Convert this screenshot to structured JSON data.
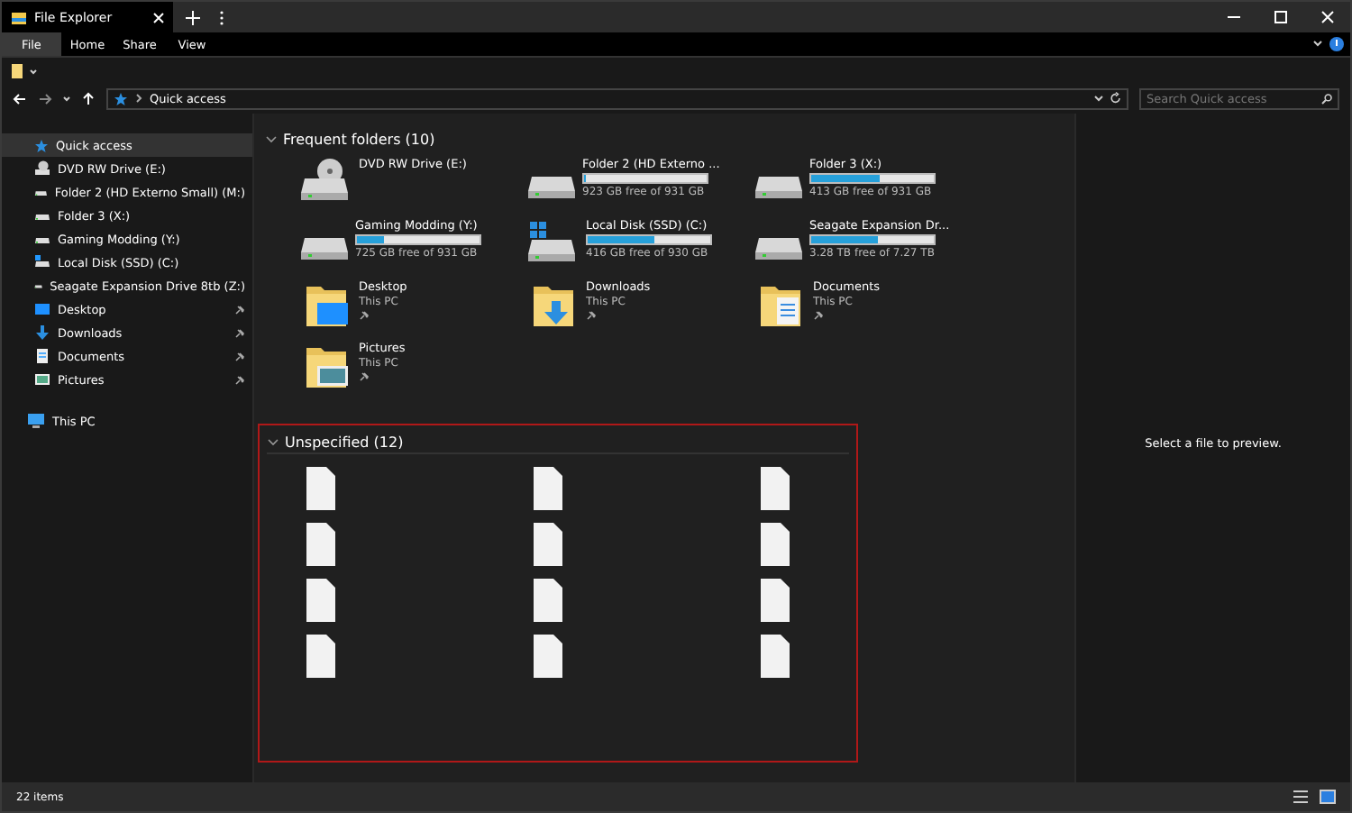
{
  "window": {
    "title": "File Explorer"
  },
  "ribbon_tabs": [
    {
      "label": "File",
      "selected": true
    },
    {
      "label": "Home",
      "selected": false
    },
    {
      "label": "Share",
      "selected": false
    },
    {
      "label": "View",
      "selected": false
    }
  ],
  "address": {
    "path": "Quick access"
  },
  "search": {
    "placeholder": "Search Quick access"
  },
  "sidebar": {
    "items": [
      {
        "kind": "quick",
        "label": "Quick access",
        "selected": true,
        "children": [
          {
            "kind": "dvd",
            "label": "DVD RW Drive (E:)",
            "pinned": false
          },
          {
            "kind": "drive",
            "label": "Folder 2 (HD Externo Small) (M:)",
            "pinned": false
          },
          {
            "kind": "drive",
            "label": "Folder 3 (X:)",
            "pinned": false
          },
          {
            "kind": "drive",
            "label": "Gaming Modding (Y:)",
            "pinned": false
          },
          {
            "kind": "system-drive",
            "label": "Local Disk (SSD) (C:)",
            "pinned": false
          },
          {
            "kind": "drive",
            "label": "Seagate Expansion Drive 8tb (Z:)",
            "pinned": false
          },
          {
            "kind": "desktop",
            "label": "Desktop",
            "pinned": true
          },
          {
            "kind": "downloads",
            "label": "Downloads",
            "pinned": true
          },
          {
            "kind": "documents",
            "label": "Documents",
            "pinned": true
          },
          {
            "kind": "pictures",
            "label": "Pictures",
            "pinned": true
          }
        ]
      },
      {
        "kind": "pc",
        "label": "This PC",
        "selected": false
      }
    ]
  },
  "frequent": {
    "heading": "Frequent folders (10)",
    "expanded": true,
    "items": [
      {
        "kind": "dvd",
        "name": "DVD RW Drive (E:)"
      },
      {
        "kind": "drive",
        "name": "Folder 2 (HD Externo ...",
        "level": 0.01,
        "detail": "923 GB free of 931 GB"
      },
      {
        "kind": "drive",
        "name": "Folder 3 (X:)",
        "level": 0.56,
        "detail": "413 GB free of 931 GB"
      },
      {
        "kind": "drive",
        "name": "Gaming Modding (Y:)",
        "level": 0.22,
        "detail": "725 GB free of 931 GB"
      },
      {
        "kind": "system-drive",
        "name": "Local Disk (SSD) (C:)",
        "level": 0.55,
        "detail": "416 GB free of 930 GB"
      },
      {
        "kind": "drive",
        "name": "Seagate Expansion Dr...",
        "level": 0.55,
        "detail": "3.28 TB free of 7.27 TB"
      },
      {
        "kind": "desktop",
        "name": "Desktop",
        "detail": "This PC",
        "pinned": true
      },
      {
        "kind": "downloads",
        "name": "Downloads",
        "detail": "This PC",
        "pinned": true
      },
      {
        "kind": "documents",
        "name": "Documents",
        "detail": "This PC",
        "pinned": true
      },
      {
        "kind": "pictures",
        "name": "Pictures",
        "detail": "This PC",
        "pinned": true
      }
    ]
  },
  "unspecified": {
    "heading": "Unspecified (12)",
    "expanded": true,
    "items": [
      {
        "kind": "file"
      },
      {
        "kind": "file"
      },
      {
        "kind": "file"
      },
      {
        "kind": "file"
      },
      {
        "kind": "file"
      },
      {
        "kind": "file"
      },
      {
        "kind": "file"
      },
      {
        "kind": "file"
      },
      {
        "kind": "file"
      },
      {
        "kind": "file"
      },
      {
        "kind": "file"
      },
      {
        "kind": "file"
      }
    ]
  },
  "preview": {
    "message": "Select a file to preview."
  },
  "status_bar": {
    "count": "22 items"
  }
}
